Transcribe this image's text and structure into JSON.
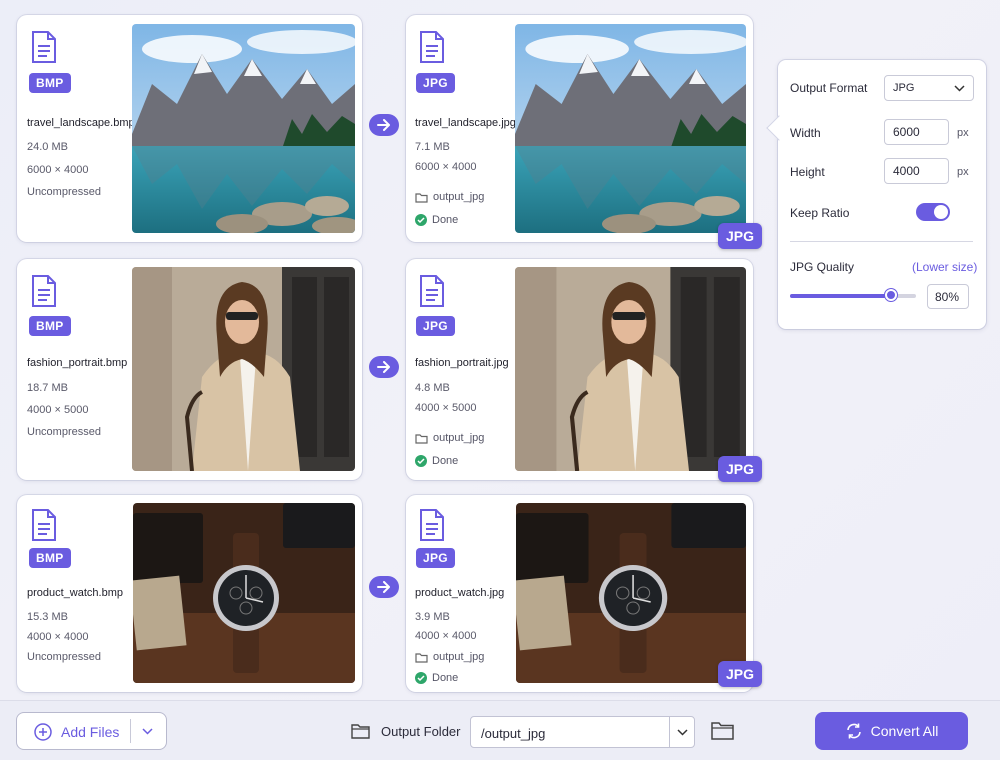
{
  "rows": [
    {
      "source": {
        "badge": "BMP",
        "name": "travel_landscape.bmp",
        "size": "24.0 MB",
        "dims": "6000 × 4000",
        "compression": "Uncompressed"
      },
      "output": {
        "badge": "JPG",
        "name": "travel_landscape.jpg",
        "size": "7.1 MB",
        "dims": "6000 × 4000",
        "folder": "output_jpg",
        "status": "Done",
        "tag": "JPG"
      }
    },
    {
      "source": {
        "badge": "BMP",
        "name": "fashion_portrait.bmp",
        "size": "18.7 MB",
        "dims": "4000 × 5000",
        "compression": "Uncompressed"
      },
      "output": {
        "badge": "JPG",
        "name": "fashion_portrait.jpg",
        "size": "4.8 MB",
        "dims": "4000 × 5000",
        "folder": "output_jpg",
        "status": "Done",
        "tag": "JPG"
      }
    },
    {
      "source": {
        "badge": "BMP",
        "name": "product_watch.bmp",
        "size": "15.3 MB",
        "dims": "4000 × 4000",
        "compression": "Uncompressed"
      },
      "output": {
        "badge": "JPG",
        "name": "product_watch.jpg",
        "size": "3.9 MB",
        "dims": "4000 × 4000",
        "folder": "output_jpg",
        "status": "Done",
        "tag": "JPG"
      }
    }
  ],
  "settings": {
    "output_format_label": "Output Format",
    "output_format_value": "JPG",
    "width_label": "Width",
    "width_value": "6000",
    "height_label": "Height",
    "height_value": "4000",
    "unit": "px",
    "keep_ratio_label": "Keep Ratio",
    "keep_ratio_on": true,
    "quality_label": "JPG Quality",
    "quality_hint": "(Lower size)",
    "quality_value": "80%",
    "quality_fraction": 0.8
  },
  "bottom": {
    "add_files_label": "Add Files",
    "output_folder_label": "Output Folder",
    "output_folder_value": "/output_jpg",
    "convert_label": "Convert All"
  },
  "colors": {
    "accent": "#6a5ce0",
    "done": "#2ea66a"
  }
}
